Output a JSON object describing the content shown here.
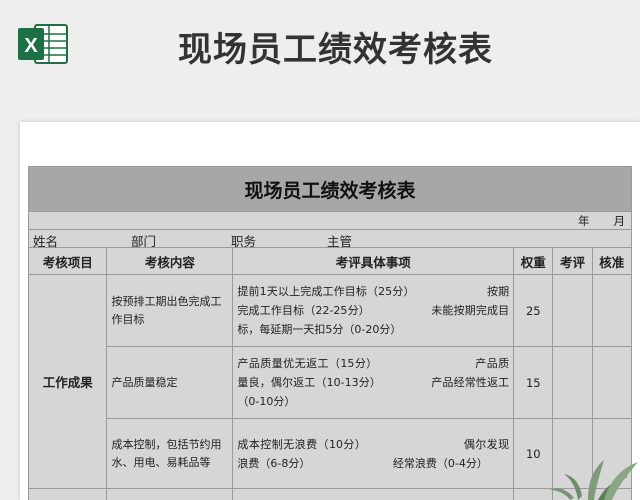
{
  "banner": {
    "title": "现场员工绩效考核表",
    "icon": "excel-icon",
    "icon_color": "#1d7044"
  },
  "sheet": {
    "title": "现场员工绩效考核表",
    "date": {
      "year": "年",
      "month": "月"
    },
    "info": {
      "name": "姓名",
      "dept": "部门",
      "position": "职务",
      "supervisor": "主管"
    },
    "headers": [
      "考核项目",
      "考核内容",
      "考评具体事项",
      "权重",
      "考评",
      "核准"
    ],
    "category": "工作成果",
    "rows": [
      {
        "content": "按预排工期出色完成工作目标",
        "detail": "提前1天以上完成工作目标（25分）　　　　　　　按期完成工作目标（22-25分）　　　　　　未能按期完成目标，每延期一天扣5分（0-20分）",
        "weight": "25"
      },
      {
        "content": "产品质量稳定",
        "detail": "产品质量优无返工（15分）　　　　　　　　　产品质量良，偶尔返工（10-13分）　　　　　产品经常性返工（0-10分）",
        "weight": "15"
      },
      {
        "content": "成本控制，包括节约用水、用电、易耗品等",
        "detail": "成本控制无浪费（10分）　　　　　　　　　偶尔发现浪费（6-8分）　　　　　　　　经常浪费（0-4分）",
        "weight": "10"
      }
    ]
  },
  "colors": {
    "title_bar": "#a7a7a7",
    "cell_bg": "#d6d6d6",
    "border": "#9a9a9a",
    "background": "#eeeeee"
  }
}
